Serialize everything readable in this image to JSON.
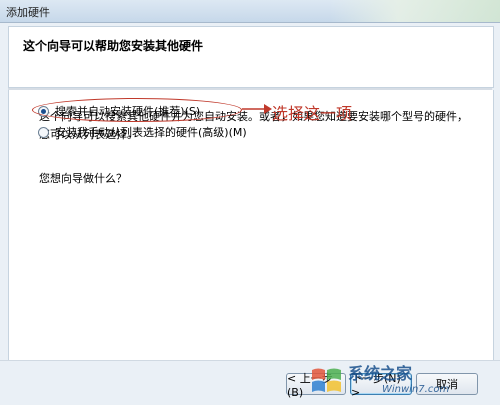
{
  "window": {
    "title": "添加硬件"
  },
  "header": {
    "heading": "这个向导可以帮助您安装其他硬件"
  },
  "content": {
    "description": "这个向导可以搜索其他硬件并为您自动安装。或者，如果您知道要安装哪个型号的硬件，您可以从列表选择。",
    "question": "您想向导做什么？",
    "options": [
      {
        "label": "搜索并自动安装硬件(推荐)(S)",
        "selected": true
      },
      {
        "label": "安装我手动从列表选择的硬件(高级)(M)",
        "selected": false
      }
    ],
    "annotation": "选择这一项"
  },
  "footer": {
    "back_label": "< 上一步(B)",
    "next_label": "下一步(N) >",
    "cancel_label": "取消"
  },
  "watermark": {
    "text": "系统之家",
    "url": "Winwin7.com"
  },
  "colors": {
    "annotation": "#c0392b",
    "header_bg": "#ffffff",
    "window_bg": "#eaf0f6"
  }
}
